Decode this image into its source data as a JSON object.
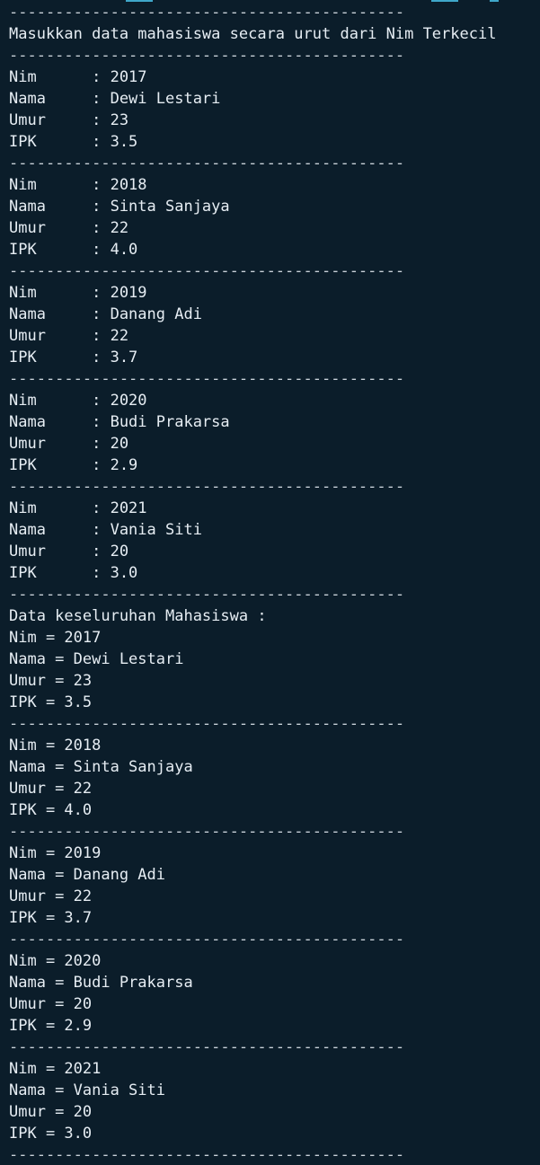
{
  "terminal": {
    "lines": [
      "-------------------------------------------",
      "Masukkan data mahasiswa secara urut dari Nim Terkecil",
      "-------------------------------------------",
      "Nim      : 2017",
      "Nama     : Dewi Lestari",
      "Umur     : 23",
      "IPK      : 3.5",
      "-------------------------------------------",
      "Nim      : 2018",
      "Nama     : Sinta Sanjaya",
      "Umur     : 22",
      "IPK      : 4.0",
      "-------------------------------------------",
      "Nim      : 2019",
      "Nama     : Danang Adi",
      "Umur     : 22",
      "IPK      : 3.7",
      "-------------------------------------------",
      "Nim      : 2020",
      "Nama     : Budi Prakarsa",
      "Umur     : 20",
      "IPK      : 2.9",
      "-------------------------------------------",
      "Nim      : 2021",
      "Nama     : Vania Siti",
      "Umur     : 20",
      "IPK      : 3.0",
      "-------------------------------------------",
      "Data keseluruhan Mahasiswa :",
      "Nim = 2017",
      "Nama = Dewi Lestari",
      "Umur = 23",
      "IPK = 3.5",
      "-------------------------------------------",
      "Nim = 2018",
      "Nama = Sinta Sanjaya",
      "Umur = 22",
      "IPK = 4.0",
      "-------------------------------------------",
      "Nim = 2019",
      "Nama = Danang Adi",
      "Umur = 22",
      "IPK = 3.7",
      "-------------------------------------------",
      "Nim = 2020",
      "Nama = Budi Prakarsa",
      "Umur = 20",
      "IPK = 2.9",
      "-------------------------------------------",
      "Nim = 2021",
      "Nama = Vania Siti",
      "Umur = 20",
      "IPK = 3.0",
      "-------------------------------------------"
    ]
  },
  "colors": {
    "background": "#0b1d2a",
    "text": "#e6edf3",
    "accent": "#3fa7c9"
  }
}
